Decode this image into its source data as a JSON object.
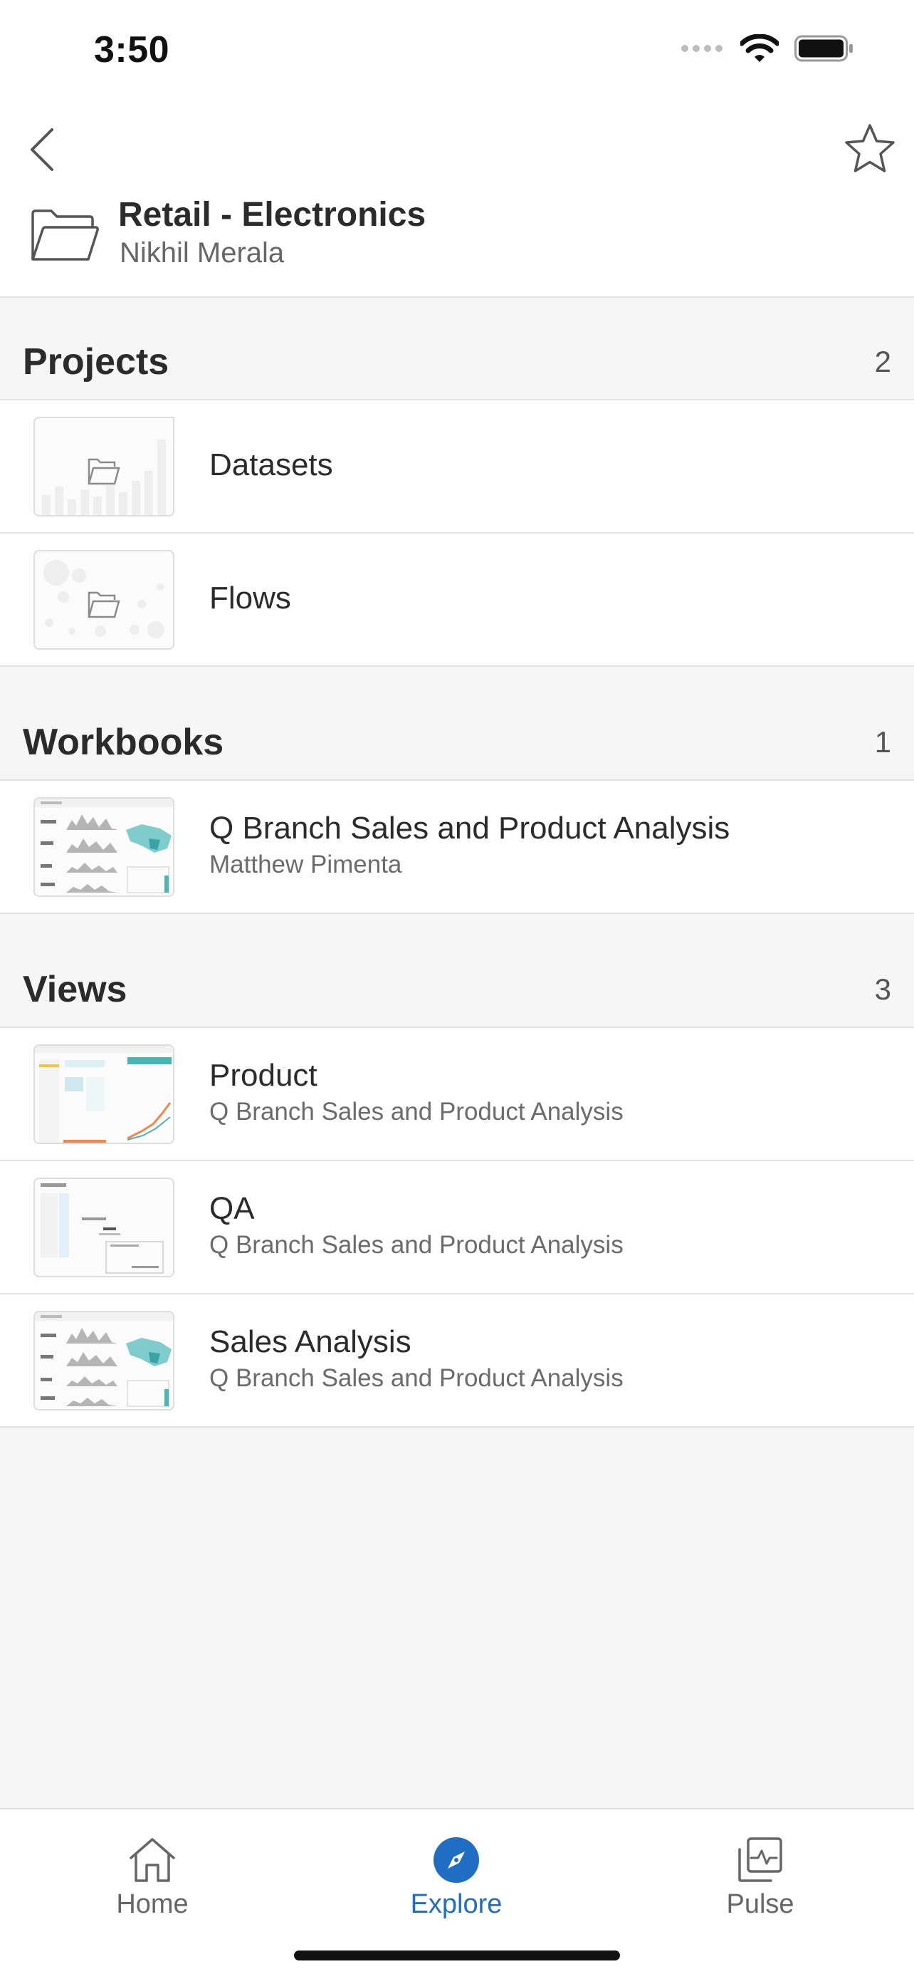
{
  "status_bar": {
    "time": "3:50"
  },
  "header": {
    "title": "Retail - Electronics",
    "subtitle": "Nikhil Merala"
  },
  "sections": {
    "projects": {
      "title": "Projects",
      "count": "2",
      "items": [
        {
          "title": "Datasets"
        },
        {
          "title": "Flows"
        }
      ]
    },
    "workbooks": {
      "title": "Workbooks",
      "count": "1",
      "items": [
        {
          "title": "Q Branch Sales and Product Analysis",
          "subtitle": "Matthew Pimenta"
        }
      ]
    },
    "views": {
      "title": "Views",
      "count": "3",
      "items": [
        {
          "title": "Product",
          "subtitle": "Q Branch Sales and Product Analysis"
        },
        {
          "title": "QA",
          "subtitle": "Q Branch Sales and Product Analysis"
        },
        {
          "title": "Sales Analysis",
          "subtitle": "Q Branch Sales and Product Analysis"
        }
      ]
    }
  },
  "tab_bar": {
    "home": "Home",
    "explore": "Explore",
    "pulse": "Pulse"
  },
  "colors": {
    "accent": "#1f6ec4",
    "background": "#f6f6f6",
    "teal": "#4ab5b5"
  },
  "icons": {
    "back": "chevron-left-icon",
    "favorite": "star-icon",
    "folder": "folder-open-icon",
    "home": "home-icon",
    "explore": "compass-icon",
    "pulse": "pulse-icon"
  }
}
